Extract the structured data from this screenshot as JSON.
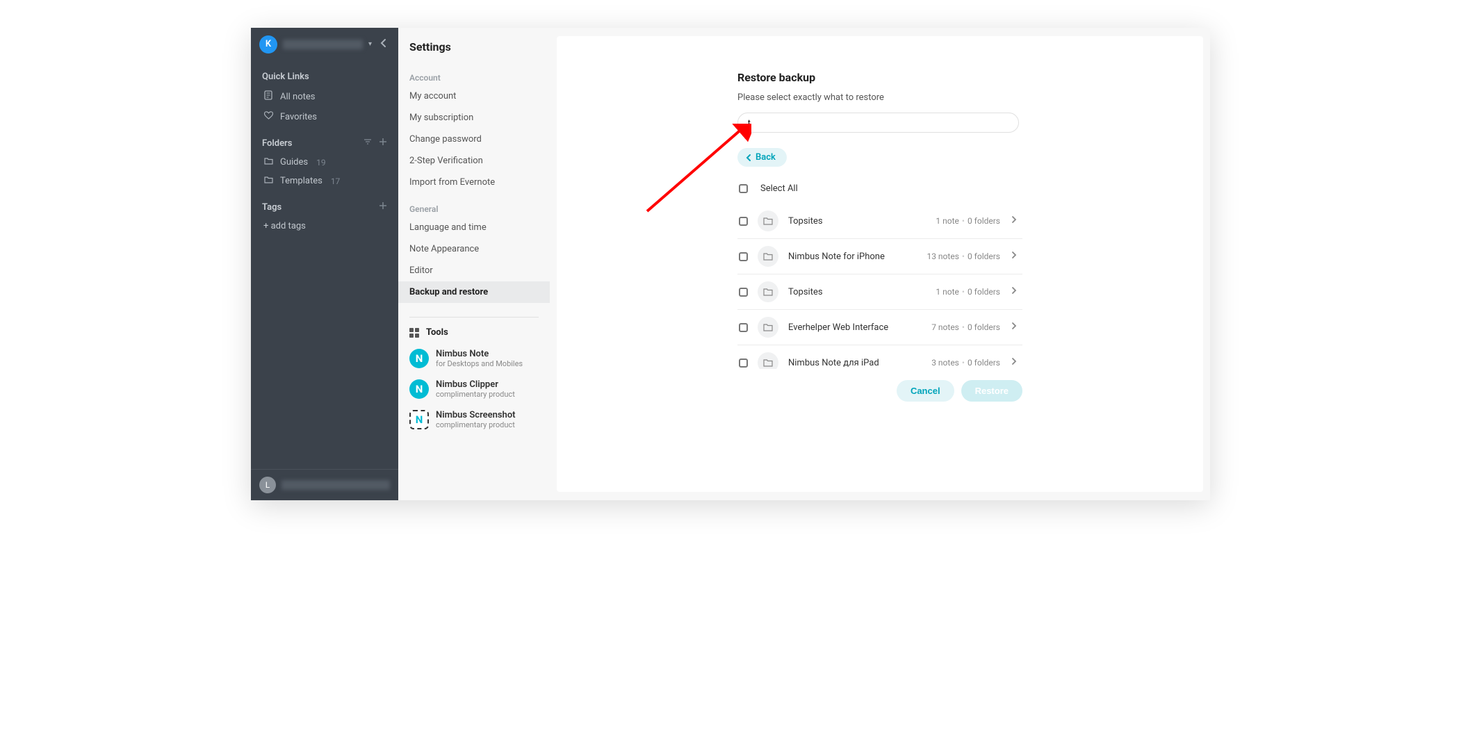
{
  "sidebar": {
    "avatar_letter": "K",
    "quick_links_label": "Quick Links",
    "all_notes": "All notes",
    "favorites": "Favorites",
    "folders_label": "Folders",
    "folders": [
      {
        "name": "Guides",
        "count": "19"
      },
      {
        "name": "Templates",
        "count": "17"
      }
    ],
    "tags_label": "Tags",
    "add_tags": "+ add tags",
    "bottom_avatar": "L"
  },
  "settings": {
    "title": "Settings",
    "account_label": "Account",
    "account_items": [
      "My account",
      "My subscription",
      "Change password",
      "2-Step Verification",
      "Import from Evernote"
    ],
    "general_label": "General",
    "general_items": [
      "Language and time",
      "Note Appearance",
      "Editor",
      "Backup and restore"
    ],
    "active_item": "Backup and restore",
    "tools_label": "Tools",
    "tools": [
      {
        "name": "Nimbus Note",
        "sub": "for Desktops and Mobiles",
        "icon": "N"
      },
      {
        "name": "Nimbus Clipper",
        "sub": "complimentary product",
        "icon": "N"
      },
      {
        "name": "Nimbus Screenshot",
        "sub": "complimentary product",
        "icon": "N"
      }
    ]
  },
  "restore": {
    "title": "Restore backup",
    "description": "Please select exactly what to restore",
    "search_value": "t",
    "back_label": "Back",
    "select_all": "Select All",
    "rows": [
      {
        "name": "Topsites",
        "notes": "1 note",
        "folders": "0 folders"
      },
      {
        "name": "Nimbus Note for iPhone",
        "notes": "13 notes",
        "folders": "0 folders"
      },
      {
        "name": "Topsites",
        "notes": "1 note",
        "folders": "0 folders"
      },
      {
        "name": "Everhelper Web Interface",
        "notes": "7 notes",
        "folders": "0 folders"
      },
      {
        "name": "Nimbus Note для iPad",
        "notes": "3 notes",
        "folders": "0 folders"
      }
    ],
    "cancel_label": "Cancel",
    "restore_label": "Restore"
  }
}
